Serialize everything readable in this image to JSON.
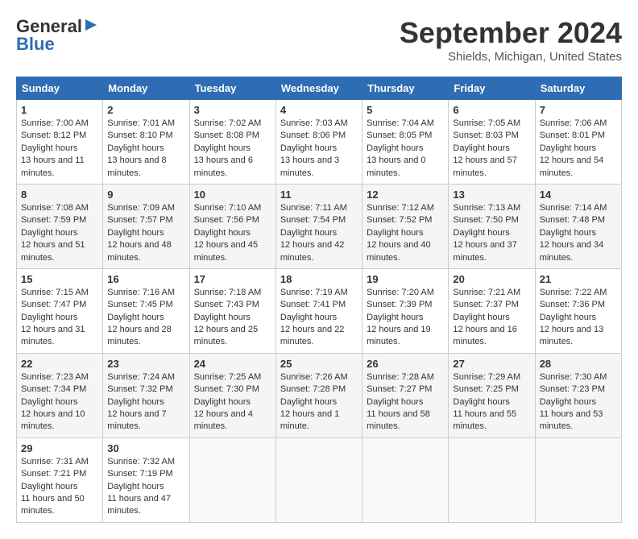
{
  "header": {
    "logo_general": "General",
    "logo_blue": "Blue",
    "month_title": "September 2024",
    "location": "Shields, Michigan, United States"
  },
  "weekdays": [
    "Sunday",
    "Monday",
    "Tuesday",
    "Wednesday",
    "Thursday",
    "Friday",
    "Saturday"
  ],
  "weeks": [
    [
      {
        "day": "1",
        "sunrise": "7:00 AM",
        "sunset": "8:12 PM",
        "daylight": "13 hours and 11 minutes."
      },
      {
        "day": "2",
        "sunrise": "7:01 AM",
        "sunset": "8:10 PM",
        "daylight": "13 hours and 8 minutes."
      },
      {
        "day": "3",
        "sunrise": "7:02 AM",
        "sunset": "8:08 PM",
        "daylight": "13 hours and 6 minutes."
      },
      {
        "day": "4",
        "sunrise": "7:03 AM",
        "sunset": "8:06 PM",
        "daylight": "13 hours and 3 minutes."
      },
      {
        "day": "5",
        "sunrise": "7:04 AM",
        "sunset": "8:05 PM",
        "daylight": "13 hours and 0 minutes."
      },
      {
        "day": "6",
        "sunrise": "7:05 AM",
        "sunset": "8:03 PM",
        "daylight": "12 hours and 57 minutes."
      },
      {
        "day": "7",
        "sunrise": "7:06 AM",
        "sunset": "8:01 PM",
        "daylight": "12 hours and 54 minutes."
      }
    ],
    [
      {
        "day": "8",
        "sunrise": "7:08 AM",
        "sunset": "7:59 PM",
        "daylight": "12 hours and 51 minutes."
      },
      {
        "day": "9",
        "sunrise": "7:09 AM",
        "sunset": "7:57 PM",
        "daylight": "12 hours and 48 minutes."
      },
      {
        "day": "10",
        "sunrise": "7:10 AM",
        "sunset": "7:56 PM",
        "daylight": "12 hours and 45 minutes."
      },
      {
        "day": "11",
        "sunrise": "7:11 AM",
        "sunset": "7:54 PM",
        "daylight": "12 hours and 42 minutes."
      },
      {
        "day": "12",
        "sunrise": "7:12 AM",
        "sunset": "7:52 PM",
        "daylight": "12 hours and 40 minutes."
      },
      {
        "day": "13",
        "sunrise": "7:13 AM",
        "sunset": "7:50 PM",
        "daylight": "12 hours and 37 minutes."
      },
      {
        "day": "14",
        "sunrise": "7:14 AM",
        "sunset": "7:48 PM",
        "daylight": "12 hours and 34 minutes."
      }
    ],
    [
      {
        "day": "15",
        "sunrise": "7:15 AM",
        "sunset": "7:47 PM",
        "daylight": "12 hours and 31 minutes."
      },
      {
        "day": "16",
        "sunrise": "7:16 AM",
        "sunset": "7:45 PM",
        "daylight": "12 hours and 28 minutes."
      },
      {
        "day": "17",
        "sunrise": "7:18 AM",
        "sunset": "7:43 PM",
        "daylight": "12 hours and 25 minutes."
      },
      {
        "day": "18",
        "sunrise": "7:19 AM",
        "sunset": "7:41 PM",
        "daylight": "12 hours and 22 minutes."
      },
      {
        "day": "19",
        "sunrise": "7:20 AM",
        "sunset": "7:39 PM",
        "daylight": "12 hours and 19 minutes."
      },
      {
        "day": "20",
        "sunrise": "7:21 AM",
        "sunset": "7:37 PM",
        "daylight": "12 hours and 16 minutes."
      },
      {
        "day": "21",
        "sunrise": "7:22 AM",
        "sunset": "7:36 PM",
        "daylight": "12 hours and 13 minutes."
      }
    ],
    [
      {
        "day": "22",
        "sunrise": "7:23 AM",
        "sunset": "7:34 PM",
        "daylight": "12 hours and 10 minutes."
      },
      {
        "day": "23",
        "sunrise": "7:24 AM",
        "sunset": "7:32 PM",
        "daylight": "12 hours and 7 minutes."
      },
      {
        "day": "24",
        "sunrise": "7:25 AM",
        "sunset": "7:30 PM",
        "daylight": "12 hours and 4 minutes."
      },
      {
        "day": "25",
        "sunrise": "7:26 AM",
        "sunset": "7:28 PM",
        "daylight": "12 hours and 1 minute."
      },
      {
        "day": "26",
        "sunrise": "7:28 AM",
        "sunset": "7:27 PM",
        "daylight": "11 hours and 58 minutes."
      },
      {
        "day": "27",
        "sunrise": "7:29 AM",
        "sunset": "7:25 PM",
        "daylight": "11 hours and 55 minutes."
      },
      {
        "day": "28",
        "sunrise": "7:30 AM",
        "sunset": "7:23 PM",
        "daylight": "11 hours and 53 minutes."
      }
    ],
    [
      {
        "day": "29",
        "sunrise": "7:31 AM",
        "sunset": "7:21 PM",
        "daylight": "11 hours and 50 minutes."
      },
      {
        "day": "30",
        "sunrise": "7:32 AM",
        "sunset": "7:19 PM",
        "daylight": "11 hours and 47 minutes."
      },
      null,
      null,
      null,
      null,
      null
    ]
  ]
}
